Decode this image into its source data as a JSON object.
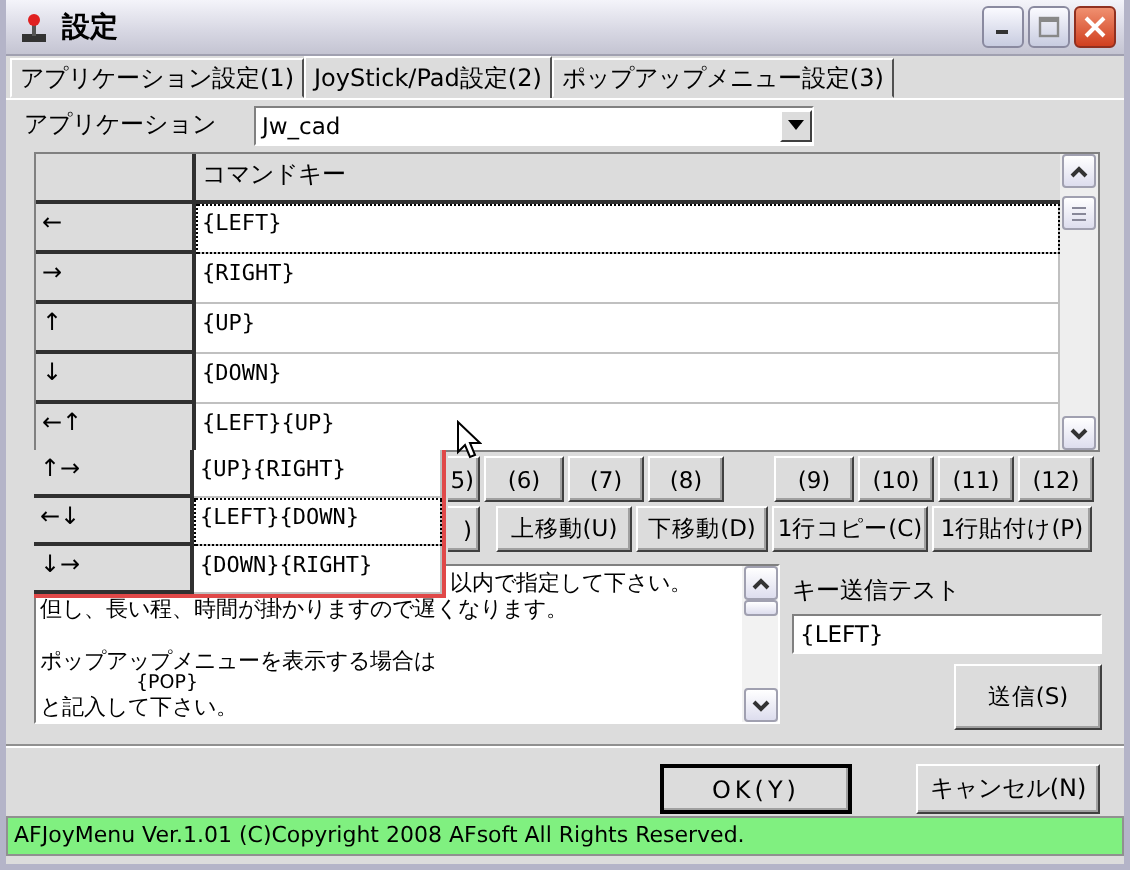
{
  "window": {
    "title": "設定"
  },
  "tabs": [
    {
      "label": "アプリケーション設定(1)",
      "selected": false
    },
    {
      "label": "JoyStick/Pad設定(2)",
      "selected": true
    },
    {
      "label": "ポップアップメニュー設定(3)",
      "selected": false
    }
  ],
  "application": {
    "label": "アプリケーション",
    "value": "Jw_cad"
  },
  "grid": {
    "columns": [
      "コマンドキー"
    ],
    "rows": [
      {
        "key": "←",
        "command": "{LEFT}",
        "focused": true
      },
      {
        "key": "→",
        "command": "{RIGHT}",
        "focused": false
      },
      {
        "key": "↑",
        "command": "{UP}",
        "focused": false
      },
      {
        "key": "↓",
        "command": "{DOWN}",
        "focused": false
      },
      {
        "key": "←↑",
        "command": "{LEFT}{UP}",
        "focused": false
      }
    ]
  },
  "overflow_rows": [
    {
      "key": "↑→",
      "command": "{UP}{RIGHT}",
      "focused": false
    },
    {
      "key": "←↓",
      "command": "{LEFT}{DOWN}",
      "focused": true
    },
    {
      "key": "↓→",
      "command": "{DOWN}{RIGHT}",
      "focused": false
    }
  ],
  "number_buttons": [
    "5)",
    "(6)",
    "(7)",
    "(8)",
    "(9)",
    "(10)",
    "(11)",
    "(12)"
  ],
  "action_buttons": [
    ")",
    "上移動(U)",
    "下移動(D)",
    "1行コピー(C)",
    "1行貼付け(P)"
  ],
  "help_text": [
    [
      "以内で指定して下さい。",
      "但し、長い程、時間が掛かりますので遅くなります。"
    ],
    [
      "ポップアップメニューを表示する場合は",
      "{POP}",
      "と記入して下さい。"
    ]
  ],
  "key_test": {
    "label": "キー送信テスト",
    "value": "{LEFT}",
    "button": "送信(S)"
  },
  "dialog_buttons": [
    {
      "label": "OK(Y)",
      "default": true
    },
    {
      "label": "キャンセル(N)",
      "default": false
    }
  ],
  "status_bar": "AFJoyMenu Ver.1.01 (C)Copyright 2008 AFsoft All Rights Reserved."
}
